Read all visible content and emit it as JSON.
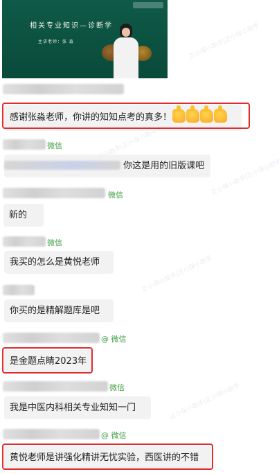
{
  "video": {
    "board_title": "相关专业知识—诊断学",
    "board_subtitle": "主讲老师：张 淼"
  },
  "watermark": {
    "text": "正小保小助手|正小保小助手"
  },
  "messages": [
    {
      "source": "",
      "text": "感谢张淼老师，你讲的知知点考的真多！",
      "highlighted": true,
      "emoji": "thumbs-up-x4"
    },
    {
      "source": "微信",
      "text": "你这是用的旧版课吧",
      "highlighted": false
    },
    {
      "source": "微信",
      "text": "新的",
      "highlighted": false
    },
    {
      "source": "微信",
      "text": "我买的怎么是黄悦老师",
      "highlighted": false
    },
    {
      "source": "",
      "text": "你买的是精解题库是吧",
      "highlighted": false
    },
    {
      "source": "@ 微信",
      "text": "是金题点睛2023年",
      "highlighted": true
    },
    {
      "source": "微信",
      "text": "我是中医内科相关专业知知一门",
      "highlighted": false
    },
    {
      "source": "@ 微信",
      "text": "黄悦老师是讲强化精讲无忧实验，西医讲的不错",
      "highlighted": true
    }
  ],
  "colors": {
    "highlight": "#e02b2b",
    "source": "#43a047",
    "bubble": "#f2f2f2"
  }
}
